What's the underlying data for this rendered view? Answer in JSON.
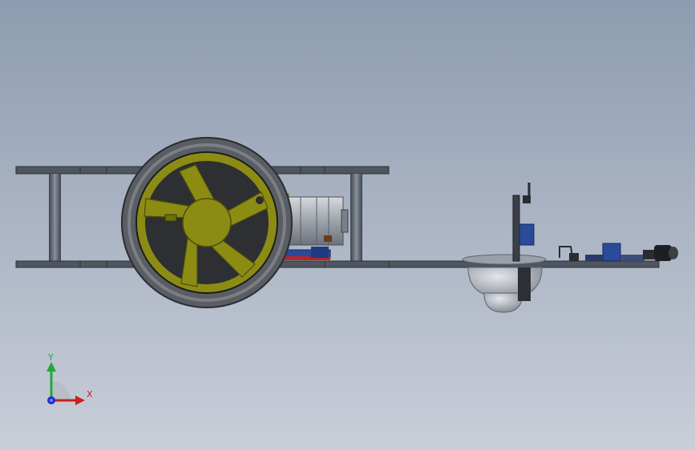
{
  "viewport": {
    "background_top": "#8d9cb0",
    "background_bottom": "#c9ced8"
  },
  "colors": {
    "plate": "#4f5660",
    "plate_edge": "#2c3036",
    "standoff": "#5c6470",
    "tire": "#5a5d62",
    "rim": "#8c8c14",
    "rim_dark": "#4e4e08",
    "motor_yellow": "#d8d23c",
    "motor_silver": "#a6aab2",
    "pcb_blue": "#2a4a9a",
    "pcb_red": "#b02828",
    "caster": "#b5b9c2",
    "axis_x": "#cc1f1f",
    "axis_y": "#1fa83a",
    "axis_z": "#1f2fcc"
  },
  "triad": {
    "x_label": "X",
    "y_label": "Y",
    "icons": [
      "axis-x-icon",
      "axis-y-icon",
      "axis-z-icon",
      "origin-icon"
    ]
  }
}
